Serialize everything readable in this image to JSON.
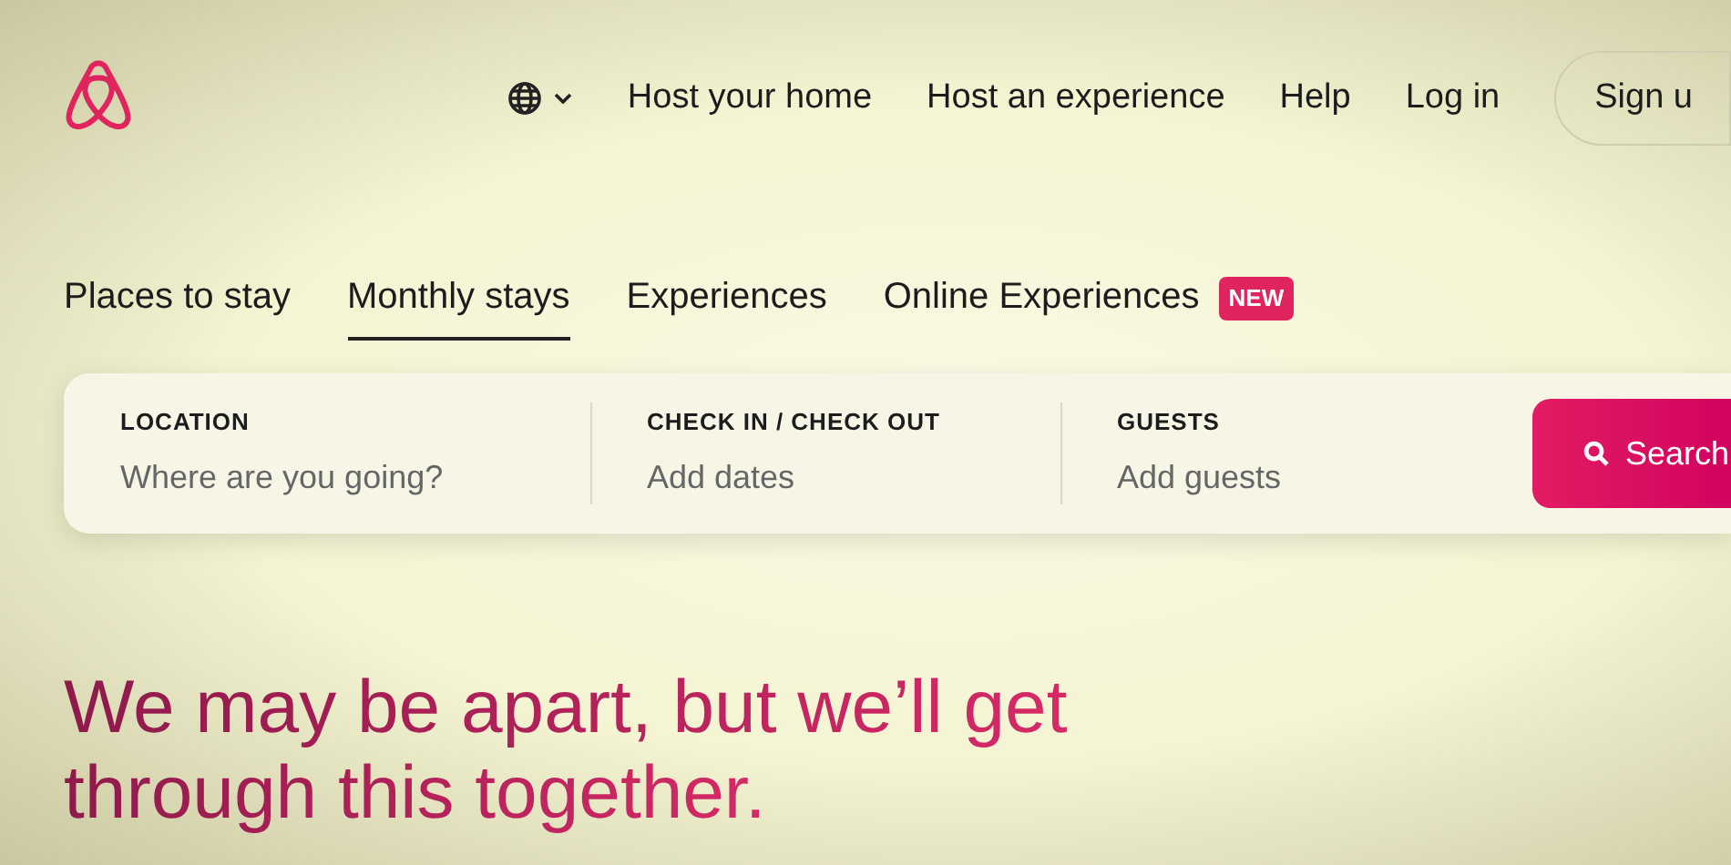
{
  "nav": {
    "links": [
      "Host your home",
      "Host an experience",
      "Help",
      "Log in"
    ],
    "signup": "Sign u"
  },
  "tabs": [
    {
      "label": "Places to stay",
      "selected": false
    },
    {
      "label": "Monthly stays",
      "selected": true
    },
    {
      "label": "Experiences",
      "selected": false
    },
    {
      "label": "Online Experiences",
      "selected": false,
      "badge": "NEW"
    }
  ],
  "search": {
    "fields": [
      {
        "label": "LOCATION",
        "placeholder": "Where are you going?"
      },
      {
        "label": "CHECK IN / CHECK OUT",
        "placeholder": "Add dates"
      },
      {
        "label": "GUESTS",
        "placeholder": "Add guests"
      }
    ],
    "button": "Search"
  },
  "headline": [
    "We may be apart, but we’ll get",
    "through this together."
  ]
}
